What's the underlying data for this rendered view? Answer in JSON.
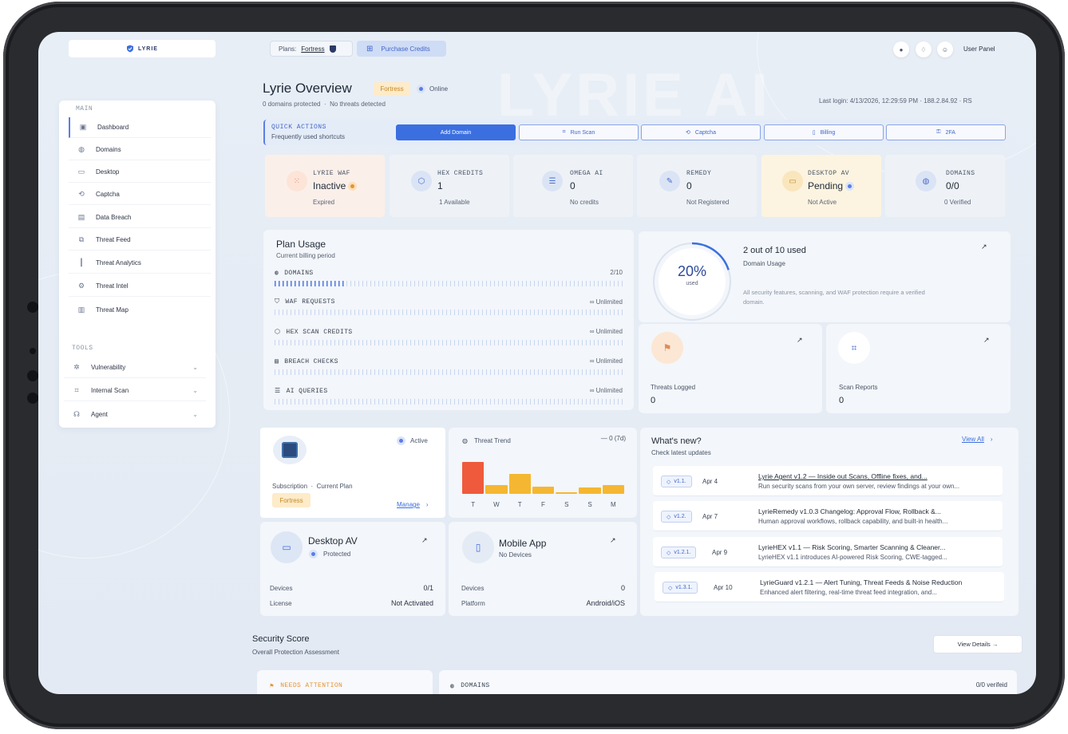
{
  "brand": {
    "name": "LYRIE"
  },
  "watermark": "LYRIE AI",
  "header": {
    "plans_label": "Plans:",
    "plan_name": "Fortress",
    "purchase_label": "Purchase Credits",
    "user_panel": "User Panel"
  },
  "sidebar": {
    "main_label": "MAIN",
    "tools_label": "TOOLS",
    "items": [
      {
        "label": "Dashboard",
        "icon": "dashboard-icon"
      },
      {
        "label": "Domains",
        "icon": "globe-icon"
      },
      {
        "label": "Desktop",
        "icon": "monitor-icon"
      },
      {
        "label": "Captcha",
        "icon": "captcha-icon"
      },
      {
        "label": "Data Breach",
        "icon": "database-icon"
      },
      {
        "label": "Threat Feed",
        "icon": "feed-icon"
      },
      {
        "label": "Threat Analytics",
        "icon": "bar-chart-icon"
      },
      {
        "label": "Threat Intel",
        "icon": "intel-icon"
      },
      {
        "label": "Threat Map",
        "icon": "map-icon"
      }
    ],
    "tools": [
      {
        "label": "Vulnerability",
        "icon": "bug-icon"
      },
      {
        "label": "Internal Scan",
        "icon": "scan-icon"
      },
      {
        "label": "Agent",
        "icon": "agent-icon"
      }
    ]
  },
  "overview": {
    "title": "Lyrie Overview",
    "badge": "Fortress",
    "status": "Online",
    "domains_protected": "0 domains protected",
    "sep": "·",
    "threats": "No threats detected",
    "last_login": "Last login: 4/13/2026, 12:29:59 PM  ·  188.2.84.92  ·  RS"
  },
  "quick_actions": {
    "title": "QUICK ACTIONS",
    "subtitle": "Frequently used shortcuts",
    "buttons": [
      "Add Domain",
      "Run Scan",
      "Captcha",
      "Billing",
      "2FA"
    ]
  },
  "stats": [
    {
      "label": "LYRIE WAF",
      "value": "Inactive",
      "sub": "Expired",
      "icon": "grid-icon"
    },
    {
      "label": "HEX CREDITS",
      "value": "1",
      "sub": "1 Available",
      "icon": "cube-icon"
    },
    {
      "label": "OMEGA AI",
      "value": "0",
      "sub": "No credits",
      "icon": "server-icon"
    },
    {
      "label": "REMEDY",
      "value": "0",
      "sub": "Not Registered",
      "icon": "pen-icon"
    },
    {
      "label": "DESKTOP AV",
      "value": "Pending",
      "sub": "Not Active",
      "icon": "monitor-icon"
    },
    {
      "label": "DOMAINS",
      "value": "0/0",
      "sub": "0 Verified",
      "icon": "globe-icon"
    }
  ],
  "plan_usage": {
    "title": "Plan Usage",
    "subtitle": "Current billing period",
    "rows": [
      {
        "label": "DOMAINS",
        "right": "2/10",
        "fill": 0.2
      },
      {
        "label": "WAF REQUESTS",
        "right": "∞ Unlimited",
        "fill": 0
      },
      {
        "label": "HEX SCAN CREDITS",
        "right": "∞ Unlimited",
        "fill": 0
      },
      {
        "label": "BREACH CHECKS",
        "right": "∞ Unlimited",
        "fill": 0
      },
      {
        "label": "AI QUERIES",
        "right": "∞ Unlimited",
        "fill": 0
      }
    ]
  },
  "domain_usage": {
    "percent": "20%",
    "percent_sub": "used",
    "percent_value": 0.2,
    "headline": "2 out of 10 used",
    "label": "Domain Usage",
    "note": "All security features, scanning, and WAF protection require a verified domain."
  },
  "threats_logged": {
    "label": "Threats Logged",
    "value": "0"
  },
  "scan_reports": {
    "label": "Scan Reports",
    "value": "0"
  },
  "subscription": {
    "status": "Active",
    "label": "Subscription",
    "current": "Current Plan",
    "plan": "Fortress",
    "manage": "Manage"
  },
  "threat_trend": {
    "title": "Threat Trend",
    "summary": "— 0 (7d)"
  },
  "chart_data": {
    "type": "bar",
    "categories": [
      "T",
      "W",
      "T",
      "F",
      "S",
      "S",
      "M"
    ],
    "values": [
      1.0,
      0.28,
      0.62,
      0.22,
      0.04,
      0.2,
      0.28
    ],
    "colors": [
      "#ef5a3c",
      "#f5b731",
      "#f5b731",
      "#f5b731",
      "#f5b731",
      "#f5b731",
      "#f5b731"
    ]
  },
  "desktop_av": {
    "title": "Desktop AV",
    "status": "Protected",
    "devices_label": "Devices",
    "devices_value": "0/1",
    "license_label": "License",
    "license_value": "Not Activated"
  },
  "mobile_app": {
    "title": "Mobile App",
    "status": "No Devices",
    "devices_label": "Devices",
    "devices_value": "0",
    "platform_label": "Platform",
    "platform_value": "Android/iOS"
  },
  "whats_new": {
    "title": "What's new?",
    "subtitle": "Check latest updates",
    "view_all": "View All",
    "items": [
      {
        "tag": "v1.1.",
        "date": "Apr 4",
        "head": "Lyrie Agent v1.2 — Inside out Scans, Offline fixes, and...",
        "body": "Run security scans from your own server, review findings at your own..."
      },
      {
        "tag": "v1.2.",
        "date": "Apr 7",
        "head": "LyrieRemedy v1.0.3 Changelog: Approval Flow, Rollback &...",
        "body": "Human approval workflows, rollback capability, and built-in health..."
      },
      {
        "tag": "v1.2.1.",
        "date": "Apr 9",
        "head": "LyrieHEX v1.1 — Risk Scoring, Smarter Scanning & Cleaner...",
        "body": "LyrieHEX v1.1 introduces AI-powered Risk Scoring, CWE-tagged..."
      },
      {
        "tag": "v1.3.1.",
        "date": "Apr 10",
        "head": "LyrieGuard v1.2.1 — Alert Tuning, Threat Feeds & Noise Reduction",
        "body": "Enhanced alert filtering, real-time threat feed integration, and..."
      }
    ]
  },
  "security_score": {
    "title": "Security Score",
    "subtitle": "Overall Protection Assessment",
    "view_details": "View Details →",
    "needs_attention": "NEEDS ATTENTION",
    "domains_label": "DOMAINS",
    "domains_value": "0/0 verifeid"
  },
  "colors": {
    "accent": "#3b6fe0",
    "warning": "#f5b731",
    "danger": "#ef5a3c",
    "badge": "#fdebc9"
  }
}
